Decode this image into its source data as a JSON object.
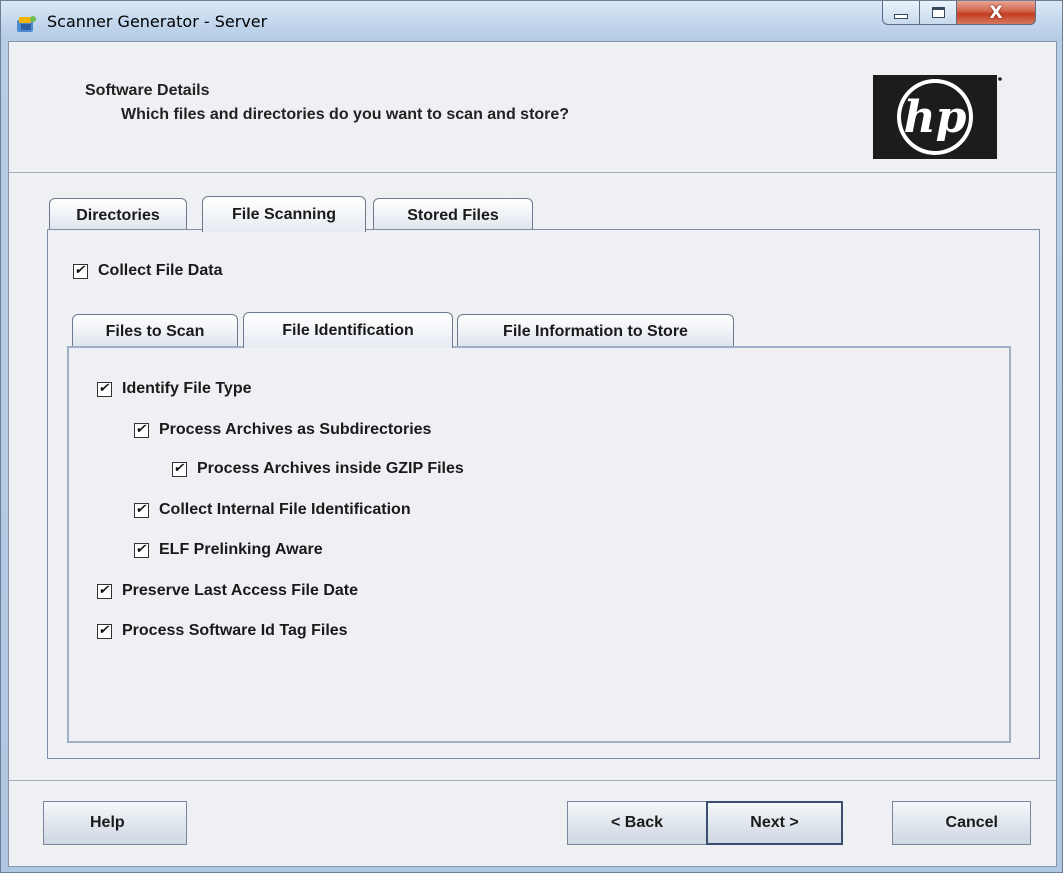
{
  "window": {
    "title": "Scanner Generator - Server",
    "controls": {
      "minimize": "minimize",
      "maximize": "maximize",
      "close": "X"
    }
  },
  "header": {
    "title": "Software Details",
    "subtitle": "Which files and directories do you want to scan and store?",
    "logo_text": "hp"
  },
  "outer_tabs": [
    {
      "label": "Directories",
      "active": false
    },
    {
      "label": "File Scanning",
      "active": true
    },
    {
      "label": "Stored Files",
      "active": false
    }
  ],
  "collect_file_data": {
    "label": "Collect File Data",
    "checked": true
  },
  "inner_tabs": [
    {
      "label": "Files to Scan",
      "active": false
    },
    {
      "label": "File Identification",
      "active": true
    },
    {
      "label": "File Information to Store",
      "active": false
    }
  ],
  "options": [
    {
      "label": "Identify File Type",
      "checked": true
    },
    {
      "label": "Process Archives as Subdirectories",
      "checked": true
    },
    {
      "label": "Process Archives inside GZIP Files",
      "checked": true
    },
    {
      "label": "Collect Internal File Identification",
      "checked": true
    },
    {
      "label": "ELF Prelinking Aware",
      "checked": true
    },
    {
      "label": "Preserve Last Access File Date",
      "checked": true
    },
    {
      "label": "Process Software Id Tag Files",
      "checked": true
    }
  ],
  "buttons": {
    "help": "Help",
    "back": "< Back",
    "next": "Next >",
    "cancel": "Cancel"
  },
  "colors": {
    "title_bar": "#c4d8ee",
    "client_bg": "#eef0f4",
    "close_button": "#c43c1e"
  },
  "icons": [
    "app-icon",
    "minimize-icon",
    "maximize-icon",
    "close-icon",
    "hp-logo",
    "checkbox-checked-icon"
  ]
}
